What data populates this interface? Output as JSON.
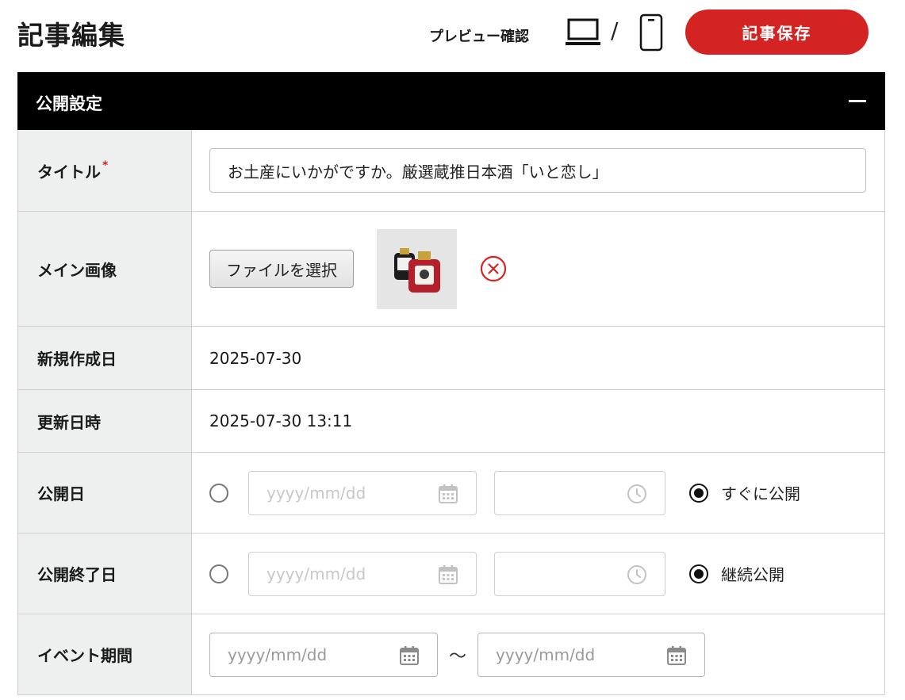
{
  "header": {
    "title": "記事編集",
    "preview_label": "プレビュー確認",
    "slash": "/",
    "save_label": "記事保存",
    "accent_color": "#d42323"
  },
  "panel": {
    "title": "公開設定",
    "collapse_icon": "minus-icon"
  },
  "fields": {
    "title": {
      "label": "タイトル",
      "required_mark": "*",
      "value": "お土産にいかがですか。厳選蔵推日本酒「いと恋し」"
    },
    "main_image": {
      "label": "メイン画像",
      "file_button": "ファイルを選択",
      "remove_icon": "circle-x-icon"
    },
    "created_date": {
      "label": "新規作成日",
      "value": "2025-07-30"
    },
    "updated_at": {
      "label": "更新日時",
      "value": "2025-07-30 13:11"
    },
    "publish_date": {
      "label": "公開日",
      "date_placeholder": "yyyy/mm/dd",
      "immediate_label": "すぐに公開",
      "selected": "immediate"
    },
    "publish_end": {
      "label": "公開終了日",
      "date_placeholder": "yyyy/mm/dd",
      "continuous_label": "継続公開",
      "selected": "continuous"
    },
    "event_period": {
      "label": "イベント期間",
      "start_placeholder": "yyyy/mm/dd",
      "separator": "～",
      "end_placeholder": "yyyy/mm/dd"
    }
  }
}
